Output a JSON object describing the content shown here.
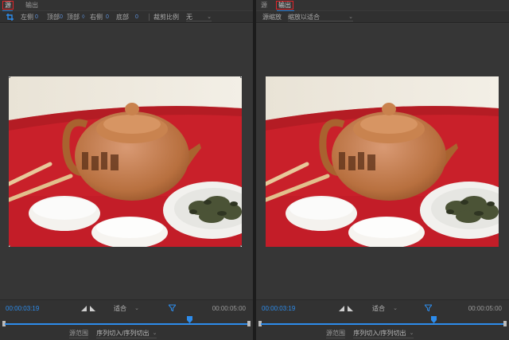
{
  "accent_colors": {
    "highlight_red": "#e0252a",
    "blue": "#2d8ceb"
  },
  "left_panel": {
    "tabs": [
      {
        "label": "源",
        "active": true
      },
      {
        "label": "输出",
        "active": false
      }
    ],
    "toolbar": {
      "left": {
        "label": "左侧",
        "value": "0"
      },
      "top": {
        "label": "顶部",
        "value": "0"
      },
      "right": {
        "label": "右侧",
        "value": "0"
      },
      "bottom": {
        "label": "底部",
        "value": "0"
      },
      "aspect_label": "裁剪比例",
      "aspect_value": "无"
    },
    "timecode_current": "00:00:03:19",
    "fit_value": "适合",
    "timecode_total": "00:00:05:00",
    "playhead_fraction": 0.76,
    "range_label": "源范围",
    "range_value": "序列切入/序列切出"
  },
  "right_panel": {
    "tabs": [
      {
        "label": "源",
        "active": false
      },
      {
        "label": "输出",
        "active": true
      }
    ],
    "toolbar": {
      "scale_label": "源缩放",
      "scale_value": "缩放以适合"
    },
    "timecode_current": "00:00:03:19",
    "fit_value": "适合",
    "timecode_total": "00:00:05:00",
    "playhead_fraction": 0.71,
    "range_label": "源范围",
    "range_value": "序列切入/序列切出"
  }
}
